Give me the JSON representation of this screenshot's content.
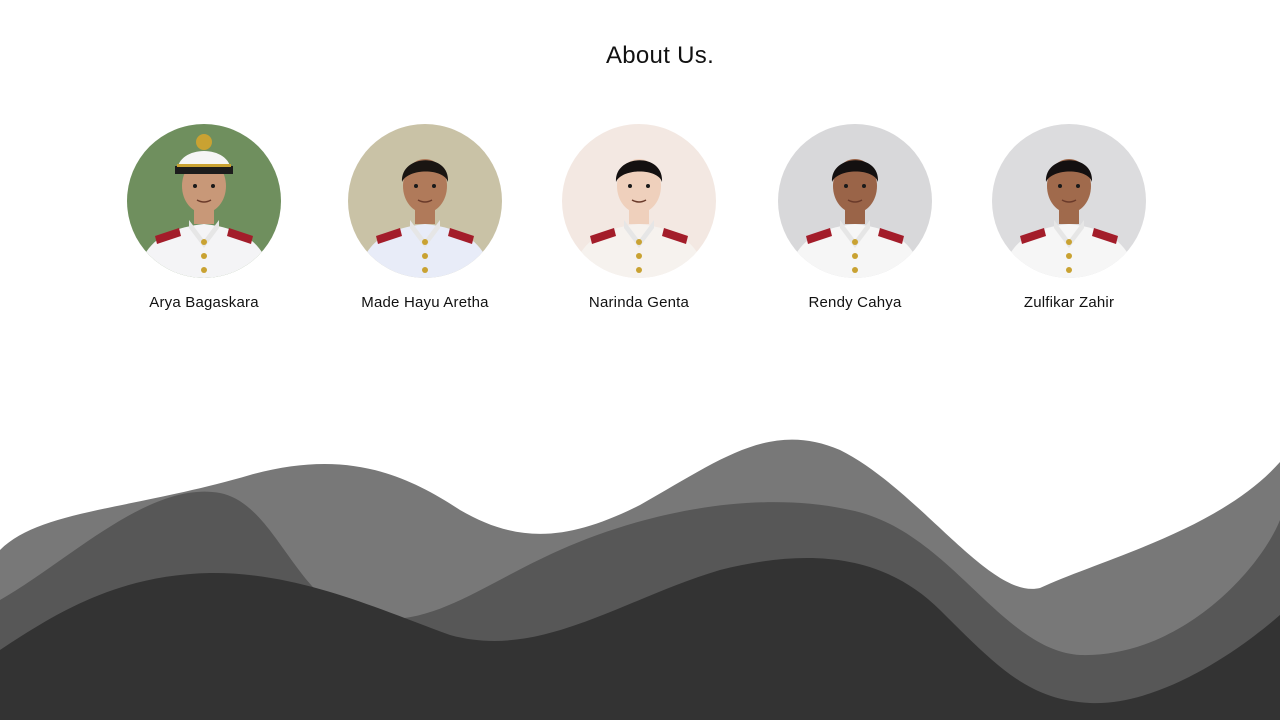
{
  "page": {
    "title": "About Us."
  },
  "members": [
    {
      "name": "Arya Bagaskara",
      "avatar": "portrait-photo",
      "bg": "#6f8f5e",
      "skin": "#c89878",
      "uniform": "#f4f4f6",
      "hat": true,
      "hair": "#1c1410"
    },
    {
      "name": "Made Hayu Aretha",
      "avatar": "portrait-photo",
      "bg": "#c9c2a6",
      "skin": "#b07a5a",
      "uniform": "#e8ecf8",
      "hat": false,
      "hair": "#1a1512"
    },
    {
      "name": "Narinda Genta",
      "avatar": "portrait-photo",
      "bg": "#f3e8e2",
      "skin": "#efd0bc",
      "uniform": "#f6f2ee",
      "hat": false,
      "hair": "#141010"
    },
    {
      "name": "Rendy Cahya",
      "avatar": "portrait-photo",
      "bg": "#d8d8da",
      "skin": "#9a6448",
      "uniform": "#f6f6f6",
      "hat": false,
      "hair": "#141010"
    },
    {
      "name": "Zulfikar Zahir",
      "avatar": "portrait-photo",
      "bg": "#dcdcde",
      "skin": "#a06a4c",
      "uniform": "#f6f6f6",
      "hat": false,
      "hair": "#141010"
    }
  ],
  "colors": {
    "wave_light": "#787878",
    "wave_mid": "#575757",
    "wave_dark": "#333333"
  }
}
